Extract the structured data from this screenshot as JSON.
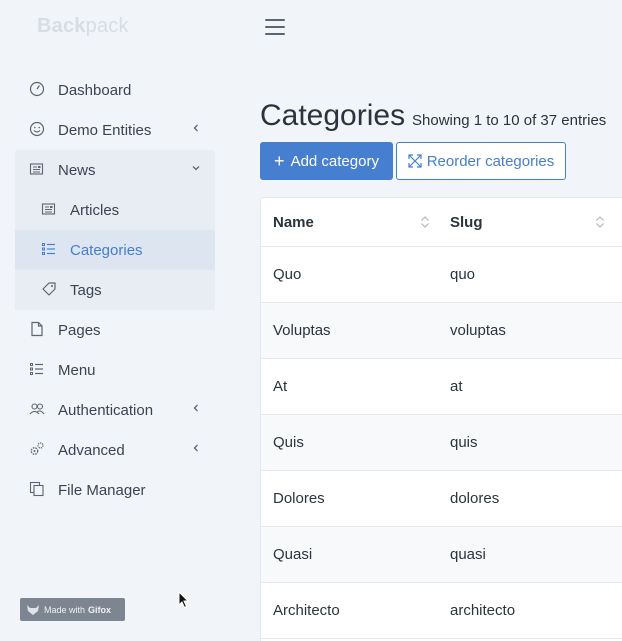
{
  "brand": {
    "bold": "Back",
    "light": "pack"
  },
  "sidebar": {
    "items": [
      {
        "label": "Dashboard",
        "icon": "dashboard-icon"
      },
      {
        "label": "Demo Entities",
        "icon": "smile-icon",
        "chevron": "left"
      },
      {
        "label": "News",
        "icon": "newspaper-icon",
        "chevron": "down",
        "children": [
          {
            "label": "Articles",
            "icon": "newspaper-icon"
          },
          {
            "label": "Categories",
            "icon": "list-icon",
            "active": true
          },
          {
            "label": "Tags",
            "icon": "tag-icon"
          }
        ]
      },
      {
        "label": "Pages",
        "icon": "file-icon"
      },
      {
        "label": "Menu",
        "icon": "list-icon"
      },
      {
        "label": "Authentication",
        "icon": "users-icon",
        "chevron": "left"
      },
      {
        "label": "Advanced",
        "icon": "cogs-icon",
        "chevron": "left"
      },
      {
        "label": "File Manager",
        "icon": "files-icon"
      }
    ]
  },
  "header": {
    "title": "Categories",
    "subtitle": "Showing 1 to 10 of 37 entries",
    "add_button": "Add category",
    "reorder_button": "Reorder categories"
  },
  "table": {
    "columns": [
      "Name",
      "Slug"
    ],
    "rows": [
      [
        "Quo",
        "quo"
      ],
      [
        "Voluptas",
        "voluptas"
      ],
      [
        "At",
        "at"
      ],
      [
        "Quis",
        "quis"
      ],
      [
        "Dolores",
        "dolores"
      ],
      [
        "Quasi",
        "quasi"
      ],
      [
        "Architecto",
        "architecto"
      ]
    ]
  },
  "watermark": {
    "prefix": "Made with",
    "brand": "Gifox"
  },
  "colors": {
    "accent": "#467fcf",
    "sidebar_bg": "#f1f4f8",
    "active_bg": "#dde5f0"
  }
}
